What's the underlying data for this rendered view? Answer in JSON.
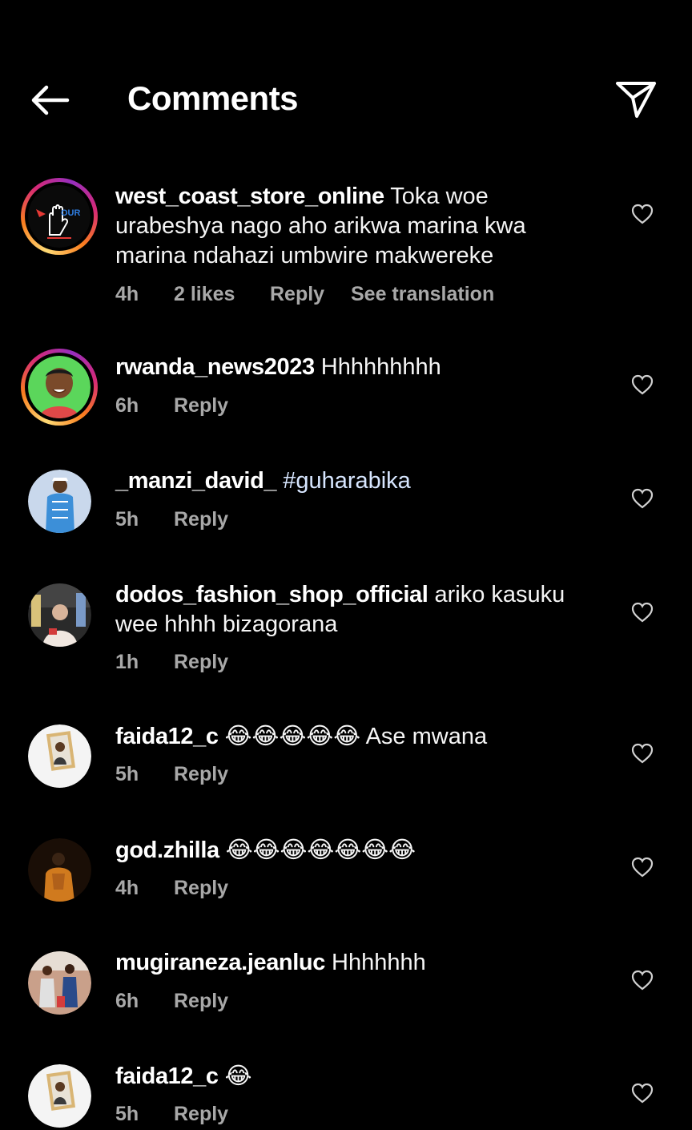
{
  "header": {
    "title": "Comments",
    "back_icon": "arrow-left-icon",
    "share_icon": "paper-plane-icon"
  },
  "colors": {
    "background": "#000000",
    "text": "#f5f5f5",
    "meta": "#a8a8a8",
    "hashtag": "#d7e6ff"
  },
  "comments": [
    {
      "username": "west_coast_store_online",
      "text": "Toka woe urabeshya nago aho arikwa marina kwa marina ndahazi umbwire makwereke",
      "time": "4h",
      "likes": "2 likes",
      "reply": "Reply",
      "translate": "See translation",
      "story_ring": true,
      "avatar_logo_text": "OUR"
    },
    {
      "username": "rwanda_news2023",
      "text": "Hhhhhhhhh",
      "time": "6h",
      "reply": "Reply",
      "story_ring": true
    },
    {
      "username": "_manzi_david_",
      "hashtag": "#guharabika",
      "time": "5h",
      "reply": "Reply"
    },
    {
      "username": "dodos_fashion_shop_official",
      "text": "ariko kasuku wee hhhh bizagorana",
      "time": "1h",
      "reply": "Reply"
    },
    {
      "username": "faida12_c",
      "emoji": "😂😂😂😂😂",
      "text": "Ase mwana",
      "time": "5h",
      "reply": "Reply"
    },
    {
      "username": "god.zhilla",
      "emoji": "😂😂😂😂😂😂😂",
      "time": "4h",
      "reply": "Reply"
    },
    {
      "username": "mugiraneza.jeanluc",
      "text": "Hhhhhhh",
      "time": "6h",
      "reply": "Reply"
    },
    {
      "username": "faida12_c",
      "emoji": "😂",
      "time": "5h",
      "reply": "Reply"
    }
  ]
}
